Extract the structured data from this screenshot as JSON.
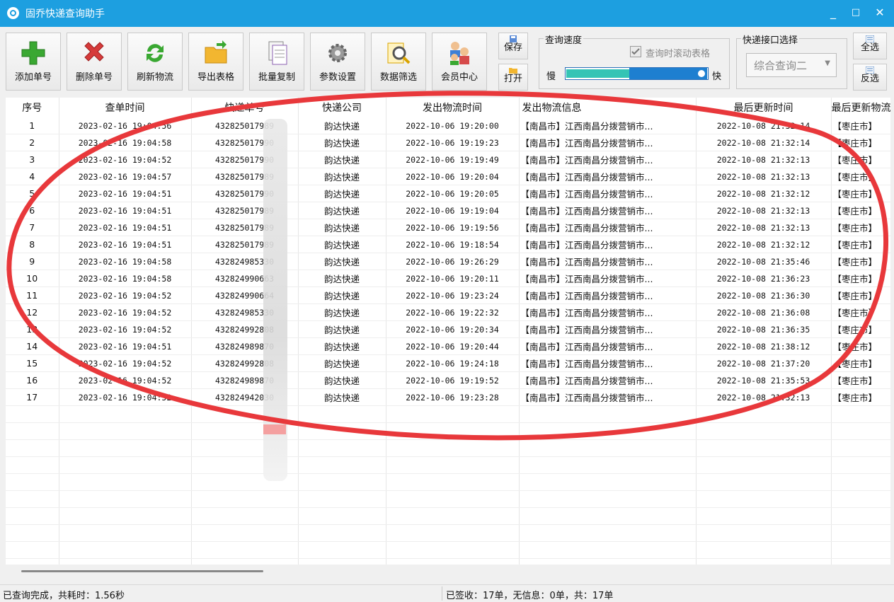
{
  "window": {
    "title": "固乔快递查询助手",
    "minimize": "_",
    "maximize": "□",
    "close": "✕"
  },
  "toolbar": {
    "add": "添加单号",
    "delete": "删除单号",
    "refresh": "刷新物流",
    "export": "导出表格",
    "batch_copy": "批量复制",
    "settings": "参数设置",
    "filter": "数据筛选",
    "member": "会员中心",
    "save": "保存",
    "open": "打开",
    "select_all": "全选",
    "invert": "反选"
  },
  "speed": {
    "legend": "查询速度",
    "scroll_label": "查询时滚动表格",
    "scroll_checked": true,
    "slow": "慢",
    "fast": "快",
    "level": 0.5
  },
  "api": {
    "legend": "快递接口选择",
    "selected": "综合查询二"
  },
  "table": {
    "columns": [
      "序号",
      "查单时间",
      "快递单号",
      "快递公司",
      "发出物流时间",
      "发出物流信息",
      "最后更新时间",
      "最后更新物流"
    ],
    "rows": [
      [
        "1",
        "2023-02-16 19:04:56",
        "432825017989",
        "韵达快递",
        "2022-10-06 19:20:00",
        "【南昌市】江西南昌分拨营销市...",
        "2022-10-08 21:32:14",
        "【枣庄市】"
      ],
      [
        "2",
        "2023-02-16 19:04:58",
        "432825017990",
        "韵达快递",
        "2022-10-06 19:19:23",
        "【南昌市】江西南昌分拨营销市...",
        "2022-10-08 21:32:14",
        "【枣庄市】"
      ],
      [
        "3",
        "2023-02-16 19:04:52",
        "432825017990",
        "韵达快递",
        "2022-10-06 19:19:49",
        "【南昌市】江西南昌分拨营销市...",
        "2022-10-08 21:32:13",
        "【枣庄市】"
      ],
      [
        "4",
        "2023-02-16 19:04:57",
        "432825017989",
        "韵达快递",
        "2022-10-06 19:20:04",
        "【南昌市】江西南昌分拨营销市...",
        "2022-10-08 21:32:13",
        "【枣庄市】"
      ],
      [
        "5",
        "2023-02-16 19:04:51",
        "432825017990",
        "韵达快递",
        "2022-10-06 19:20:05",
        "【南昌市】江西南昌分拨营销市...",
        "2022-10-08 21:32:12",
        "【枣庄市】"
      ],
      [
        "6",
        "2023-02-16 19:04:51",
        "432825017989",
        "韵达快递",
        "2022-10-06 19:19:04",
        "【南昌市】江西南昌分拨营销市...",
        "2022-10-08 21:32:13",
        "【枣庄市】"
      ],
      [
        "7",
        "2023-02-16 19:04:51",
        "432825017989",
        "韵达快递",
        "2022-10-06 19:19:56",
        "【南昌市】江西南昌分拨营销市...",
        "2022-10-08 21:32:13",
        "【枣庄市】"
      ],
      [
        "8",
        "2023-02-16 19:04:51",
        "432825017989",
        "韵达快递",
        "2022-10-06 19:18:54",
        "【南昌市】江西南昌分拨营销市...",
        "2022-10-08 21:32:12",
        "【枣庄市】"
      ],
      [
        "9",
        "2023-02-16 19:04:58",
        "432824985330",
        "韵达快递",
        "2022-10-06 19:26:29",
        "【南昌市】江西南昌分拨营销市...",
        "2022-10-08 21:35:46",
        "【枣庄市】"
      ],
      [
        "10",
        "2023-02-16 19:04:58",
        "432824990663",
        "韵达快递",
        "2022-10-06 19:20:11",
        "【南昌市】江西南昌分拨营销市...",
        "2022-10-08 21:36:23",
        "【枣庄市】"
      ],
      [
        "11",
        "2023-02-16 19:04:52",
        "432824990664",
        "韵达快递",
        "2022-10-06 19:23:24",
        "【南昌市】江西南昌分拨营销市...",
        "2022-10-08 21:36:30",
        "【枣庄市】"
      ],
      [
        "12",
        "2023-02-16 19:04:52",
        "432824985330",
        "韵达快递",
        "2022-10-06 19:22:32",
        "【南昌市】江西南昌分拨营销市...",
        "2022-10-08 21:36:08",
        "【枣庄市】"
      ],
      [
        "13",
        "2023-02-16 19:04:52",
        "432824992808",
        "韵达快递",
        "2022-10-06 19:20:34",
        "【南昌市】江西南昌分拨营销市...",
        "2022-10-08 21:36:35",
        "【枣庄市】"
      ],
      [
        "14",
        "2023-02-16 19:04:51",
        "432824989870",
        "韵达快递",
        "2022-10-06 19:20:44",
        "【南昌市】江西南昌分拨营销市...",
        "2022-10-08 21:38:12",
        "【枣庄市】"
      ],
      [
        "15",
        "2023-02-16 19:04:52",
        "432824992808",
        "韵达快递",
        "2022-10-06 19:24:18",
        "【南昌市】江西南昌分拨营销市...",
        "2022-10-08 21:37:20",
        "【枣庄市】"
      ],
      [
        "16",
        "2023-02-16 19:04:52",
        "432824989870",
        "韵达快递",
        "2022-10-06 19:19:52",
        "【南昌市】江西南昌分拨营销市...",
        "2022-10-08 21:35:53",
        "【枣庄市】"
      ],
      [
        "17",
        "2023-02-16 19:04:52",
        "432824942030",
        "韵达快递",
        "2022-10-06 19:23:28",
        "【南昌市】江西南昌分拨营销市...",
        "2022-10-08 21:32:13",
        "【枣庄市】"
      ]
    ]
  },
  "status": {
    "left": "已查询完成，共耗时：1.56秒",
    "right": "已签收：17单，无信息：0单，共：17单"
  },
  "colors": {
    "titlebar": "#1d9fe0",
    "slider_fill": "#35c4b5",
    "annotation": "#e8383b"
  }
}
